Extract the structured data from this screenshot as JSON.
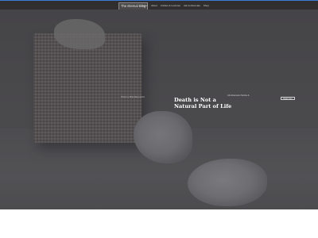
{
  "header": {
    "site_title": "The Eternal Blog",
    "nav": [
      "Home",
      "About",
      "Articles & Lectures",
      "Ask & Advocate",
      "Shop"
    ]
  },
  "hero": {
    "caption": "Photo by Mika Baumeister",
    "title": "Death is Not a Natural Part of Life",
    "aside": "Life Extension Stories &",
    "button_label": "Read more"
  }
}
